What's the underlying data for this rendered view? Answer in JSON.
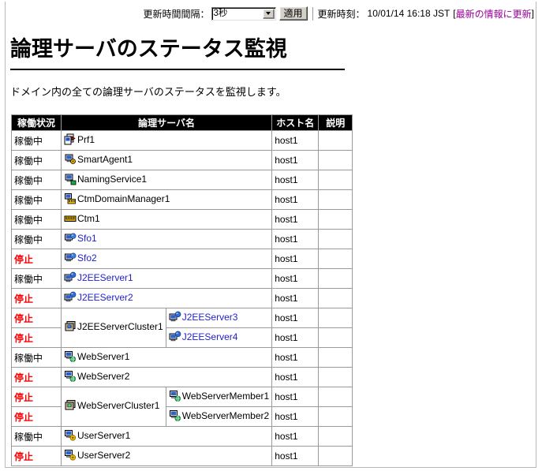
{
  "toolbar": {
    "interval_label": "更新時間間隔：",
    "interval_value": "3秒",
    "interval_options": [
      "3秒"
    ],
    "apply_label": "適用",
    "time_label": "更新時刻：",
    "time_value": "10/01/14 16:18 JST",
    "refresh_link": "最新の情報に更新",
    "bracket_open": "[",
    "bracket_close": "]",
    "link_color": "#990099"
  },
  "page": {
    "title": "論理サーバのステータス監視",
    "description": "ドメイン内の全ての論理サーバのステータスを監視します。"
  },
  "table": {
    "headers": [
      "稼働状況",
      "論理サーバ名",
      "ホスト名",
      "説明"
    ],
    "status_running": "稼働中",
    "status_stopped": "停止",
    "status_running_color": "#000000",
    "status_stopped_color": "#ff0000",
    "link_color": "#2222cc",
    "rows": [
      {
        "status": "稼働中",
        "name": "Prf1",
        "icon": "prf-icon",
        "link": false,
        "host": "host1",
        "desc": ""
      },
      {
        "status": "稼働中",
        "name": "SmartAgent1",
        "icon": "smartagent-icon",
        "link": false,
        "host": "host1",
        "desc": ""
      },
      {
        "status": "稼働中",
        "name": "NamingService1",
        "icon": "namingservice-icon",
        "link": false,
        "host": "host1",
        "desc": ""
      },
      {
        "status": "稼働中",
        "name": "CtmDomainManager1",
        "icon": "ctmdomainmanager-icon",
        "link": false,
        "host": "host1",
        "desc": ""
      },
      {
        "status": "稼働中",
        "name": "Ctm1",
        "icon": "ctm-icon",
        "link": false,
        "host": "host1",
        "desc": ""
      },
      {
        "status": "稼働中",
        "name": "Sfo1",
        "icon": "sfo-icon",
        "link": true,
        "host": "host1",
        "desc": ""
      },
      {
        "status": "停止",
        "name": "Sfo2",
        "icon": "sfo-icon",
        "link": true,
        "host": "host1",
        "desc": ""
      },
      {
        "status": "稼働中",
        "name": "J2EEServer1",
        "icon": "j2eeserver-icon",
        "link": true,
        "host": "host1",
        "desc": ""
      },
      {
        "status": "停止",
        "name": "J2EEServer2",
        "icon": "j2eeserver-icon",
        "link": true,
        "host": "host1",
        "desc": ""
      }
    ],
    "clusters": [
      {
        "cluster_name": "J2EEServerCluster1",
        "cluster_icon": "j2eecluster-icon",
        "members": [
          {
            "status": "停止",
            "name": "J2EEServer3",
            "icon": "j2eeserver-icon",
            "link": true,
            "host": "host1",
            "desc": ""
          },
          {
            "status": "停止",
            "name": "J2EEServer4",
            "icon": "j2eeserver-icon",
            "link": true,
            "host": "host1",
            "desc": ""
          }
        ]
      },
      {
        "cluster_name": "WebServerCluster1",
        "cluster_icon": "webcluster-icon",
        "members": [
          {
            "status": "停止",
            "name": "WebServerMember1",
            "icon": "webserver-icon",
            "link": false,
            "host": "host1",
            "desc": ""
          },
          {
            "status": "停止",
            "name": "WebServerMember2",
            "icon": "webserver-icon",
            "link": false,
            "host": "host1",
            "desc": ""
          }
        ]
      }
    ],
    "rows2": [
      {
        "status": "稼働中",
        "name": "WebServer1",
        "icon": "webserver-icon",
        "link": false,
        "host": "host1",
        "desc": ""
      },
      {
        "status": "停止",
        "name": "WebServer2",
        "icon": "webserver-icon",
        "link": false,
        "host": "host1",
        "desc": ""
      }
    ],
    "rows3": [
      {
        "status": "稼働中",
        "name": "UserServer1",
        "icon": "userserver-icon",
        "link": false,
        "host": "host1",
        "desc": ""
      },
      {
        "status": "停止",
        "name": "UserServer2",
        "icon": "userserver-icon",
        "link": false,
        "host": "host1",
        "desc": ""
      }
    ]
  }
}
